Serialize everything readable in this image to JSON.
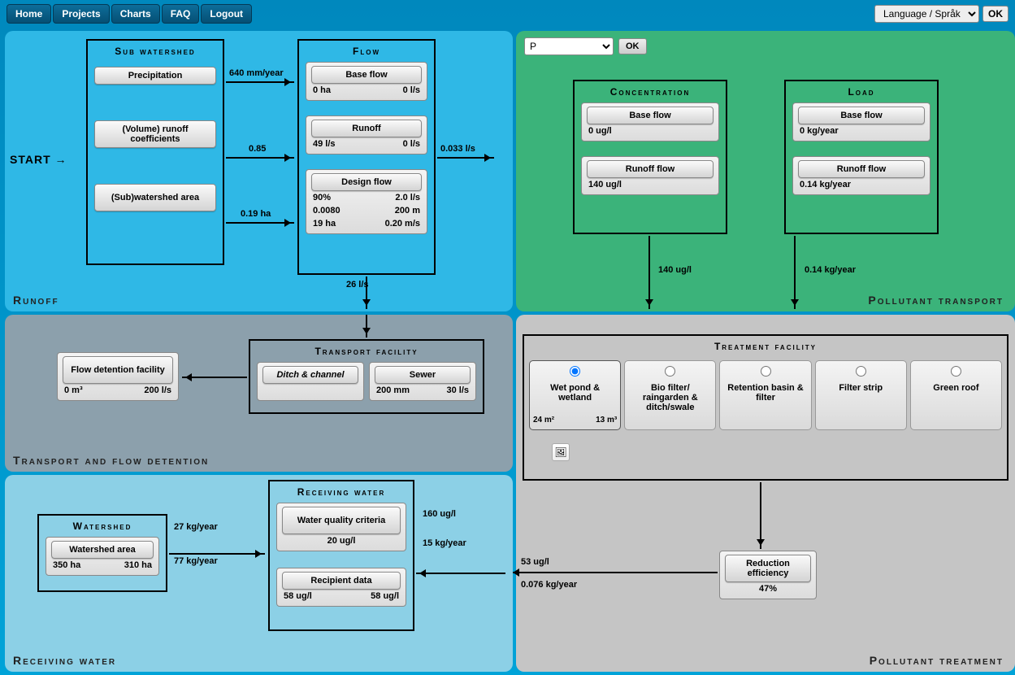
{
  "nav": {
    "home": "Home",
    "projects": "Projects",
    "charts": "Charts",
    "faq": "FAQ",
    "logout": "Logout"
  },
  "lang": {
    "selected": "Language / Språk",
    "ok": "OK"
  },
  "runoff": {
    "title": "Runoff",
    "start": "START",
    "sub_watershed": {
      "title": "Sub watershed",
      "precipitation_btn": "Precipitation",
      "precip_val": "640 mm/year",
      "runoff_coef_btn": "(Volume) runoff coefficients",
      "coef_val": "0.85",
      "area_btn": "(Sub)watershed area",
      "area_val": "0.19 ha"
    },
    "flow": {
      "title": "Flow",
      "baseflow_btn": "Base flow",
      "baseflow_ha": "0 ha",
      "baseflow_ls": "0 l/s",
      "runoff_btn": "Runoff",
      "runoff_left": "49 l/s",
      "runoff_right": "0 l/s",
      "out": "0.033 l/s",
      "design_btn": "Design flow",
      "design_pct": "90%",
      "design_ls": "2.0 l/s",
      "d1": "0.0080",
      "d2": "200 m",
      "d3": "19 ha",
      "d4": "0.20 m/s",
      "down": "26 l/s"
    }
  },
  "pollutant": {
    "title": "Pollutant transport",
    "selector": "P",
    "ok": "OK",
    "concentration": {
      "title": "Concentration",
      "baseflow_btn": "Base flow",
      "baseflow_val": "0 ug/l",
      "runoff_btn": "Runoff flow",
      "runoff_val": "140 ug/l",
      "out": "140 ug/l"
    },
    "load": {
      "title": "Load",
      "baseflow_btn": "Base flow",
      "baseflow_val": "0 kg/year",
      "runoff_btn": "Runoff flow",
      "runoff_val": "0.14 kg/year",
      "out": "0.14 kg/year"
    }
  },
  "transport_det": {
    "title": "Transport and flow detention",
    "facility": {
      "title": "Transport facility",
      "ditch_btn": "Ditch & channel",
      "sewer_btn": "Sewer",
      "sewer_mm": "200 mm",
      "sewer_ls": "30 l/s"
    },
    "detention": {
      "btn": "Flow detention facility",
      "v1": "0 m³",
      "v2": "200 l/s"
    }
  },
  "treatment": {
    "title": "Pollutant treatment",
    "facility_title": "Treatment facility",
    "opts": [
      {
        "label": "Wet pond & wetland",
        "selected": true,
        "s1": "24 m²",
        "s2": "13 m³"
      },
      {
        "label": "Bio filter/ raingarden & ditch/swale",
        "selected": false
      },
      {
        "label": "Retention basin & filter",
        "selected": false
      },
      {
        "label": "Filter strip",
        "selected": false
      },
      {
        "label": "Green roof",
        "selected": false
      }
    ],
    "reduction": {
      "btn": "Reduction efficiency",
      "val": "47%"
    },
    "out_conc": "53 ug/l",
    "out_load": "0.076 kg/year"
  },
  "receiving": {
    "title": "Receiving water",
    "watershed": {
      "title": "Watershed",
      "btn": "Watershed area",
      "v1": "350 ha",
      "v2": "310 ha",
      "arrow1": "27 kg/year",
      "arrow2": "77 kg/year"
    },
    "recv": {
      "title": "Receiving water",
      "wqc_btn": "Water quality criteria",
      "wqc_val": "20 ug/l",
      "rd_btn": "Recipient data",
      "rd_v1": "58 ug/l",
      "rd_v2": "58 ug/l",
      "in_conc": "160 ug/l",
      "in_load": "15 kg/year"
    }
  }
}
